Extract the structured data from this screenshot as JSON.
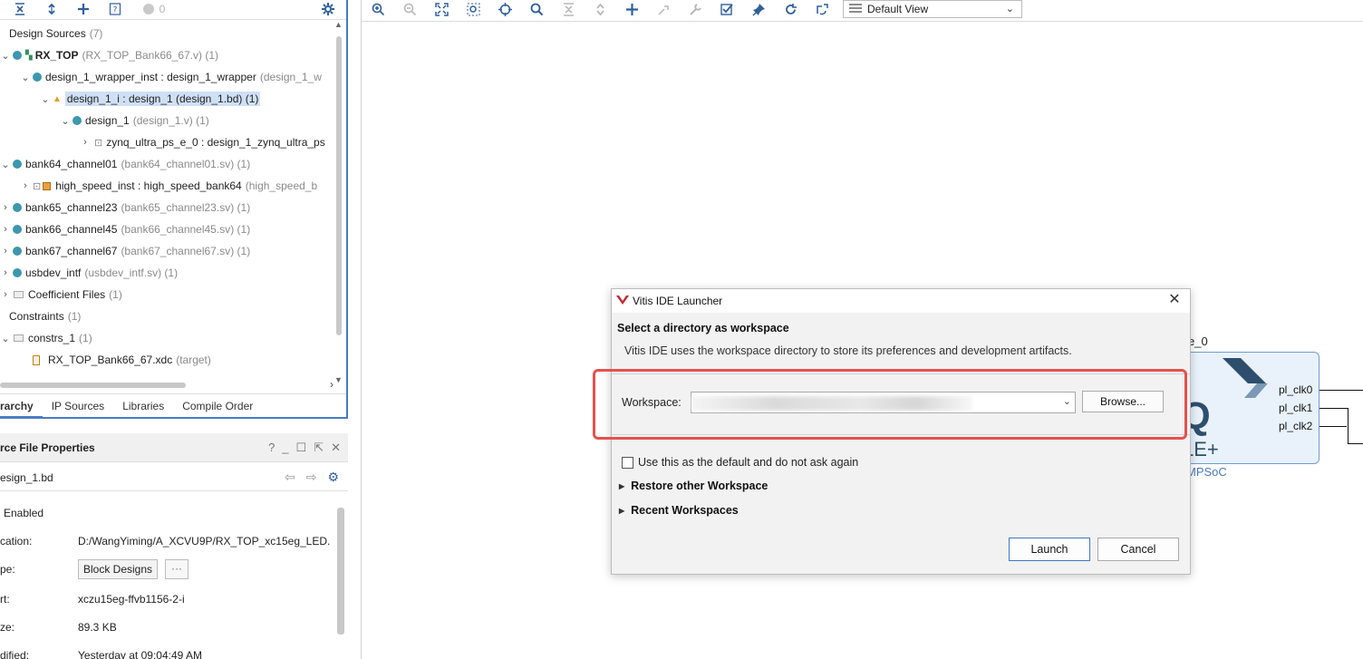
{
  "sources": {
    "toolbar": {
      "collapse_all": "collapse-all-icon",
      "expand_all": "expand-all-icon",
      "add": "add-icon",
      "help": "help-icon",
      "warnings_count": "0",
      "settings": "gear-icon"
    },
    "tree": [
      {
        "label": "Design Sources",
        "suffix": "(7)"
      },
      {
        "label": "RX_TOP",
        "suffix": "(RX_TOP_Bank66_67.v) (1)"
      },
      {
        "label": "design_1_wrapper_inst : design_1_wrapper",
        "suffix": "(design_1_w"
      },
      {
        "label": "design_1_i : design_1 (design_1.bd) (1)",
        "suffix": ""
      },
      {
        "label": "design_1",
        "suffix": "(design_1.v) (1)"
      },
      {
        "label": "zynq_ultra_ps_e_0 : design_1_zynq_ultra_ps",
        "suffix": ""
      },
      {
        "label": "bank64_channel01",
        "suffix": "(bank64_channel01.sv) (1)"
      },
      {
        "label": "high_speed_inst : high_speed_bank64",
        "suffix": "(high_speed_b"
      },
      {
        "label": "bank65_channel23",
        "suffix": "(bank65_channel23.sv) (1)"
      },
      {
        "label": "bank66_channel45",
        "suffix": "(bank66_channel45.sv) (1)"
      },
      {
        "label": "bank67_channel67",
        "suffix": "(bank67_channel67.sv) (1)"
      },
      {
        "label": "usbdev_intf",
        "suffix": "(usbdev_intf.sv) (1)"
      },
      {
        "label": "Coefficient Files",
        "suffix": "(1)"
      },
      {
        "label": "Constraints",
        "suffix": "(1)"
      },
      {
        "label": "constrs_1",
        "suffix": "(1)"
      },
      {
        "label": "RX_TOP_Bank66_67.xdc",
        "suffix": "(target)"
      }
    ],
    "tabs": [
      "rarchy",
      "IP Sources",
      "Libraries",
      "Compile Order"
    ]
  },
  "properties": {
    "title": "rce File Properties",
    "file": "esign_1.bd",
    "enabled_label": "Enabled",
    "rows": [
      {
        "key": "cation:",
        "value": "D:/WangYiming/A_XCVU9P/RX_TOP_xc15eg_LED."
      },
      {
        "key": "pe:",
        "value": "Block Designs"
      },
      {
        "key": "rt:",
        "value": "xczu15eg-ffvb1156-2-i"
      },
      {
        "key": "ze:",
        "value": "89.3 KB"
      },
      {
        "key": "dified:",
        "value": "Yesterday at 09:04:49 AM"
      }
    ],
    "more_button": "···"
  },
  "diagram": {
    "view_select": "Default View",
    "ip_name": "e_0",
    "ip_logo_text": "LE+",
    "ip_subtitle": "MPSoC",
    "pins": [
      "pl_clk0",
      "pl_clk1",
      "pl_clk2"
    ]
  },
  "dialog": {
    "title": "Vitis IDE Launcher",
    "heading": "Select a directory as workspace",
    "description": "Vitis IDE uses the workspace directory to store its preferences and development artifacts.",
    "workspace_label": "Workspace:",
    "browse_label": "Browse...",
    "default_checkbox_label": "Use this as the default and do not ask again",
    "restore_label": "Restore other Workspace",
    "recent_label": "Recent Workspaces",
    "launch_label": "Launch",
    "cancel_label": "Cancel",
    "highlight_color": "#e4524d"
  }
}
